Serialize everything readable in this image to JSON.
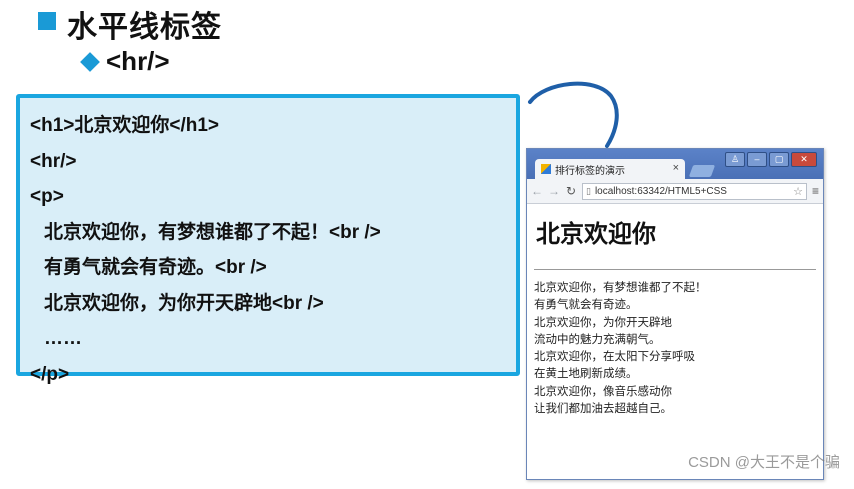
{
  "slide": {
    "title": "水平线标签",
    "subtitle": "<hr/>"
  },
  "code": {
    "lines": [
      "<h1>北京欢迎你</h1>",
      "<hr/>",
      "<p>",
      "北京欢迎你，有梦想谁都了不起！<br />",
      "有勇气就会有奇迹。<br />",
      "北京欢迎你，为你开天辟地<br />",
      "……",
      "</p>"
    ]
  },
  "browser": {
    "tab_title": "排行标签的演示",
    "tab_close": "×",
    "address": "localhost:63342/HTML5+CSS",
    "page": {
      "heading": "北京欢迎你",
      "lines": [
        "北京欢迎你，有梦想谁都了不起！",
        "有勇气就会有奇迹。",
        "北京欢迎你，为你开天辟地",
        "流动中的魅力充满朝气。",
        "北京欢迎你，在太阳下分享呼吸",
        "在黄土地刷新成绩。",
        "北京欢迎你，像音乐感动你",
        "让我们都加油去超越自己。"
      ]
    }
  },
  "watermark": "CSDN @大王不是个骗",
  "colors": {
    "accent": "#1a9ad6",
    "code_bg": "#d9eef8",
    "code_border": "#1aa6e0",
    "browser_frame": "#4a70b6"
  }
}
